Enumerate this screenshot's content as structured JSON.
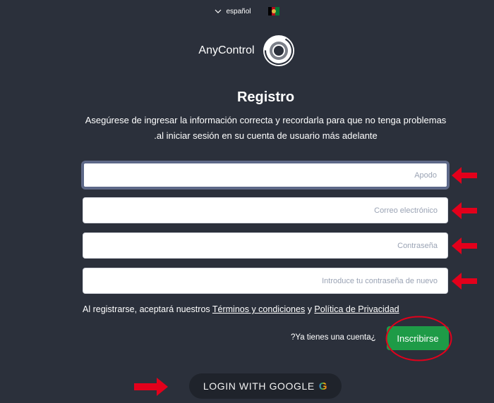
{
  "language": {
    "label": "español",
    "icon": "chevron-down-icon"
  },
  "brand": {
    "name": "AnyControl"
  },
  "form": {
    "title": "Registro",
    "description_line1": "Asegúrese de ingresar la información correcta y recordarla para que no tenga problemas",
    "description_line2": ".al iniciar sesión en su cuenta de usuario más adelante",
    "fields": [
      {
        "placeholder": "Apodo",
        "value": ""
      },
      {
        "placeholder": "Correo electrónico",
        "value": ""
      },
      {
        "placeholder": "Contraseña",
        "value": ""
      },
      {
        "placeholder": "Introduce tu contraseña de nuevo",
        "value": ""
      }
    ],
    "terms_prefix": "Al registrarse, aceptará nuestros",
    "terms_link": "Términos y condiciones",
    "terms_and": "y",
    "privacy_link": "Política de Privacidad",
    "have_account": "?Ya tienes una cuenta¿",
    "signup_label": "Inscribirse",
    "google_label": "LOGIN WITH GOOGLE",
    "google_logo": "G"
  },
  "colors": {
    "background": "#2b303b",
    "annotation_red": "#e3001b",
    "signup_green": "#1e9b47"
  }
}
